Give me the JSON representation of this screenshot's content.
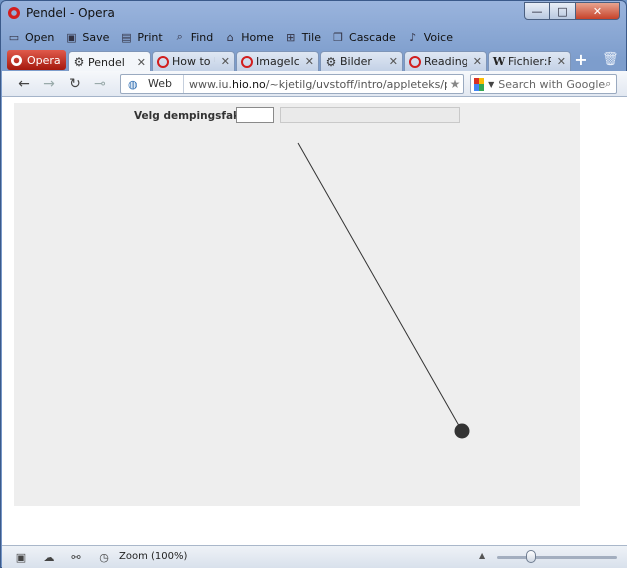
{
  "window": {
    "title": "Pendel - Opera",
    "controls": {
      "minimize": "—",
      "maximize": "□",
      "close": "✕"
    }
  },
  "menubar": [
    {
      "label": "Open",
      "icon": "folder-icon"
    },
    {
      "label": "Save",
      "icon": "save-icon"
    },
    {
      "label": "Print",
      "icon": "print-icon"
    },
    {
      "label": "Find",
      "icon": "find-icon"
    },
    {
      "label": "Home",
      "icon": "home-icon"
    },
    {
      "label": "Tile",
      "icon": "tile-icon"
    },
    {
      "label": "Cascade",
      "icon": "cascade-icon"
    },
    {
      "label": "Voice",
      "icon": "voice-icon"
    }
  ],
  "opera_button": {
    "label": "Opera"
  },
  "tabs": [
    {
      "label": "Pendel",
      "icon": "gear-icon",
      "active": true
    },
    {
      "label": "How to U...",
      "icon": "opera-icon",
      "active": false
    },
    {
      "label": "ImageIco...",
      "icon": "opera-icon",
      "active": false
    },
    {
      "label": "Bilder",
      "icon": "gear-icon",
      "active": false
    },
    {
      "label": "Reading/...",
      "icon": "opera-icon",
      "active": false
    },
    {
      "label": "Fichier:Pi...",
      "icon": "wikipedia-icon",
      "active": false
    }
  ],
  "address": {
    "badge": "Web",
    "url_prefix": "www.iu.",
    "url_domain": "hio.no",
    "url_path": "/~kjetilg/uvstoff/intro/appleteks/pendel.html"
  },
  "search": {
    "placeholder": "Search with Google"
  },
  "applet": {
    "label": "Velg dempingsfaktor:",
    "input_value": "",
    "status_text": ""
  },
  "statusbar": {
    "zoom": "Zoom (100%)",
    "zoom_level": 0.25
  },
  "colors": {
    "brand": "#d21e1e",
    "applet_bg": "#eeeeee",
    "bob": "#333333"
  }
}
